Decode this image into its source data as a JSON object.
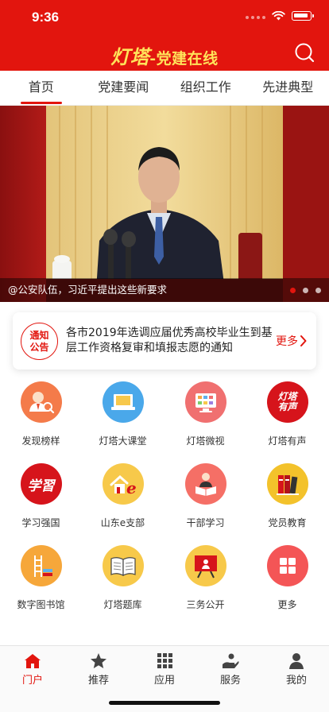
{
  "status_bar": {
    "time": "9:36"
  },
  "header": {
    "brand_main": "灯塔",
    "brand_sub": "-党建在线",
    "search_icon": "search-icon"
  },
  "tabs": [
    {
      "label": "首页",
      "active": true
    },
    {
      "label": "党建要闻",
      "active": false
    },
    {
      "label": "组织工作",
      "active": false
    },
    {
      "label": "先进典型",
      "active": false
    }
  ],
  "banner": {
    "caption": "@公安队伍，习近平提出这些新要求",
    "current_slide": 1,
    "slide_count": 3
  },
  "notice": {
    "badge_line1": "通知",
    "badge_line2": "公告",
    "text": "各市2019年选调应届优秀高校毕业生到基层工作资格复审和填报志愿的通知",
    "more_label": "更多"
  },
  "grid": [
    {
      "label": "发现榜样",
      "icon": "role-model-search-icon",
      "bg": "#f47b4a"
    },
    {
      "label": "灯塔大课堂",
      "icon": "classroom-icon",
      "bg": "#4aa8ea"
    },
    {
      "label": "灯塔微视",
      "icon": "video-screen-icon",
      "bg": "#f07070"
    },
    {
      "label": "灯塔有声",
      "icon": "audio-logo-icon",
      "bg": "#d6141b",
      "icon_text_1": "灯塔",
      "icon_text_2": "有声"
    },
    {
      "label": "学习强国",
      "icon": "study-logo-icon",
      "bg": "#d6141b",
      "icon_text": "学習"
    },
    {
      "label": "山东e支部",
      "icon": "home-e-icon",
      "bg": "#f7c94a"
    },
    {
      "label": "干部学习",
      "icon": "reading-person-icon",
      "bg": "#f56f66"
    },
    {
      "label": "党员教育",
      "icon": "books-icon",
      "bg": "#f3c22b"
    },
    {
      "label": "数字图书馆",
      "icon": "library-ladder-icon",
      "bg": "#f6a73a"
    },
    {
      "label": "灯塔题库",
      "icon": "open-book-icon",
      "bg": "#f7c94a"
    },
    {
      "label": "三务公开",
      "icon": "board-presentation-icon",
      "bg": "#f7c94a"
    },
    {
      "label": "更多",
      "icon": "grid-more-icon",
      "bg": "#f45556"
    }
  ],
  "bottom_nav": [
    {
      "label": "门户",
      "icon": "home-icon",
      "active": true
    },
    {
      "label": "推荐",
      "icon": "star-icon",
      "active": false
    },
    {
      "label": "应用",
      "icon": "apps-grid-icon",
      "active": false
    },
    {
      "label": "服务",
      "icon": "service-hand-icon",
      "active": false
    },
    {
      "label": "我的",
      "icon": "person-icon",
      "active": false
    }
  ],
  "colors": {
    "primary": "#e2150e",
    "brand_text": "#ffe35a"
  }
}
